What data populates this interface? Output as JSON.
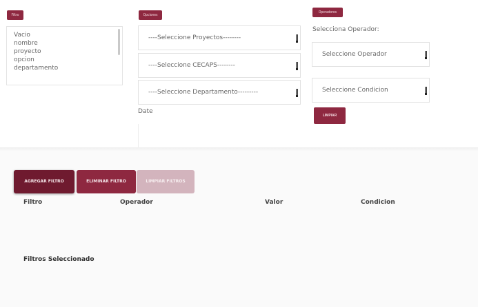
{
  "filtro_panel": {
    "badge": "Filtro",
    "items": [
      "Vacio",
      "nombre",
      "proyecto",
      "opcion",
      "departamento"
    ]
  },
  "opciones_panel": {
    "badge": "Opciones",
    "proyectos_select": "----Seleccione Proyectos--------",
    "cecaps_select": "----Seleccione CECAPS--------",
    "departamento_select": "----Seleccione Departamento---------",
    "date_label": "Date",
    "date_value": ""
  },
  "operadores_panel": {
    "badge": "Operadores",
    "operador_label": "Selecciona Operador:",
    "operador_select": "Seleccione Operador",
    "condicion_select": "Seleccione Condicion",
    "limpiar_button": "LIMPIAR"
  },
  "actions": {
    "agregar": "AGREGAR FILTRO",
    "eliminar": "ELIMINAR FILTRO",
    "limpiar_filtros": "LIMPIAR FILTROS"
  },
  "table": {
    "columns": [
      "Filtro",
      "Operador",
      "Valor",
      "Condicion"
    ]
  },
  "selected_section": {
    "title": "Filtros Seleccionado"
  },
  "colors": {
    "accent": "#8e2840",
    "accent_dark": "#6f1a2f",
    "accent_disabled": "#d3b4bd"
  }
}
